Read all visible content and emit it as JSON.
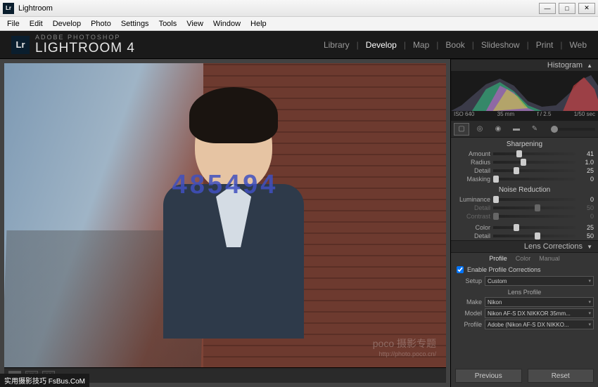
{
  "window": {
    "title": "Lightroom"
  },
  "menu": [
    "File",
    "Edit",
    "Develop",
    "Photo",
    "Settings",
    "Tools",
    "View",
    "Window",
    "Help"
  ],
  "brand": {
    "top": "ADOBE PHOTOSHOP",
    "main": "LIGHTROOM 4",
    "badge": "Lr"
  },
  "modules": {
    "items": [
      "Library",
      "Develop",
      "Map",
      "Book",
      "Slideshow",
      "Print",
      "Web"
    ],
    "active": "Develop"
  },
  "histogram": {
    "title": "Histogram",
    "iso": "ISO 640",
    "focal": "35 mm",
    "aperture": "f / 2.5",
    "shutter": "1/50 sec"
  },
  "sharpening": {
    "title": "Sharpening",
    "amount": {
      "label": "Amount",
      "value": "41",
      "pos": 28
    },
    "radius": {
      "label": "Radius",
      "value": "1.0",
      "pos": 33
    },
    "detail": {
      "label": "Detail",
      "value": "25",
      "pos": 25
    },
    "masking": {
      "label": "Masking",
      "value": "0",
      "pos": 0
    }
  },
  "noise": {
    "title": "Noise Reduction",
    "luminance": {
      "label": "Luminance",
      "value": "0",
      "pos": 0
    },
    "detail": {
      "label": "Detail",
      "value": "50",
      "pos": 50
    },
    "contrast": {
      "label": "Contrast",
      "value": "0",
      "pos": 0
    },
    "color": {
      "label": "Color",
      "value": "25",
      "pos": 25
    },
    "cdetail": {
      "label": "Detail",
      "value": "50",
      "pos": 50
    }
  },
  "lens": {
    "title": "Lens Corrections",
    "tabs": [
      "Profile",
      "Color",
      "Manual"
    ],
    "active_tab": "Profile",
    "enable": "Enable Profile Corrections",
    "setup": {
      "label": "Setup",
      "value": "Custom"
    },
    "profile_title": "Lens Profile",
    "make": {
      "label": "Make",
      "value": "Nikon"
    },
    "model": {
      "label": "Model",
      "value": "Nikon AF-S DX NIKKOR 35mm..."
    },
    "profile": {
      "label": "Profile",
      "value": "Adobe (Nikon AF-S DX NIKKO..."
    }
  },
  "buttons": {
    "previous": "Previous",
    "reset": "Reset"
  },
  "watermark": {
    "main": "poco 摄影专题",
    "url": "http://photo.poco.cn/"
  },
  "overlay": "485494",
  "footer": "实用摄影技巧 FsBus.CoM"
}
